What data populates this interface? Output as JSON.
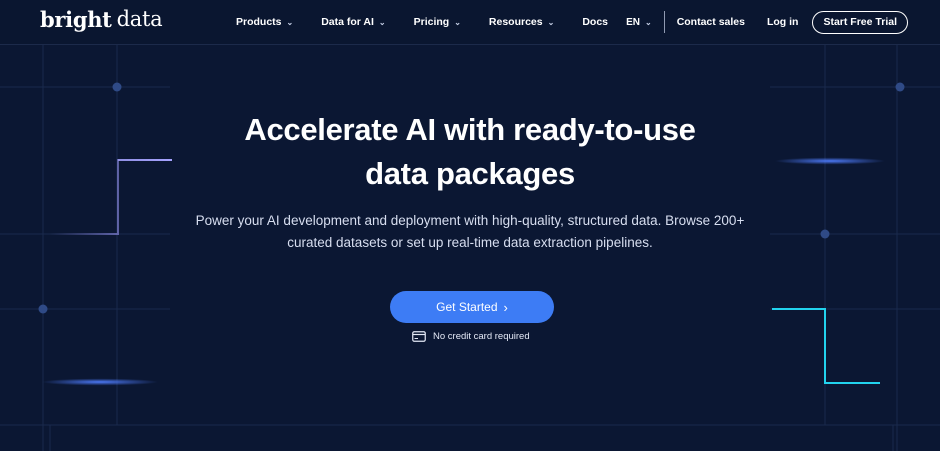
{
  "brand": {
    "logo_part1": "bright",
    "logo_part2": "data"
  },
  "nav": {
    "items": [
      {
        "label": "Products"
      },
      {
        "label": "Data for AI"
      },
      {
        "label": "Pricing"
      },
      {
        "label": "Resources"
      },
      {
        "label": "Docs"
      }
    ],
    "language": "EN",
    "contact_sales": "Contact sales",
    "login": "Log in",
    "start_trial": "Start Free Trial"
  },
  "hero": {
    "headline_line1": "Accelerate AI with ready-to-use",
    "headline_line2": "data packages",
    "subtitle_line1": "Power your AI development and deployment with high-quality, structured data. Browse 200+",
    "subtitle_line2": "curated datasets or set up real-time data extraction pipelines.",
    "cta_label": "Get Started",
    "note": "No credit card required"
  },
  "colors": {
    "background": "#0b1733",
    "accent_blue": "#3d7cf5",
    "glow_purple": "#8f8cf5",
    "glow_cyan": "#22d3ee"
  }
}
